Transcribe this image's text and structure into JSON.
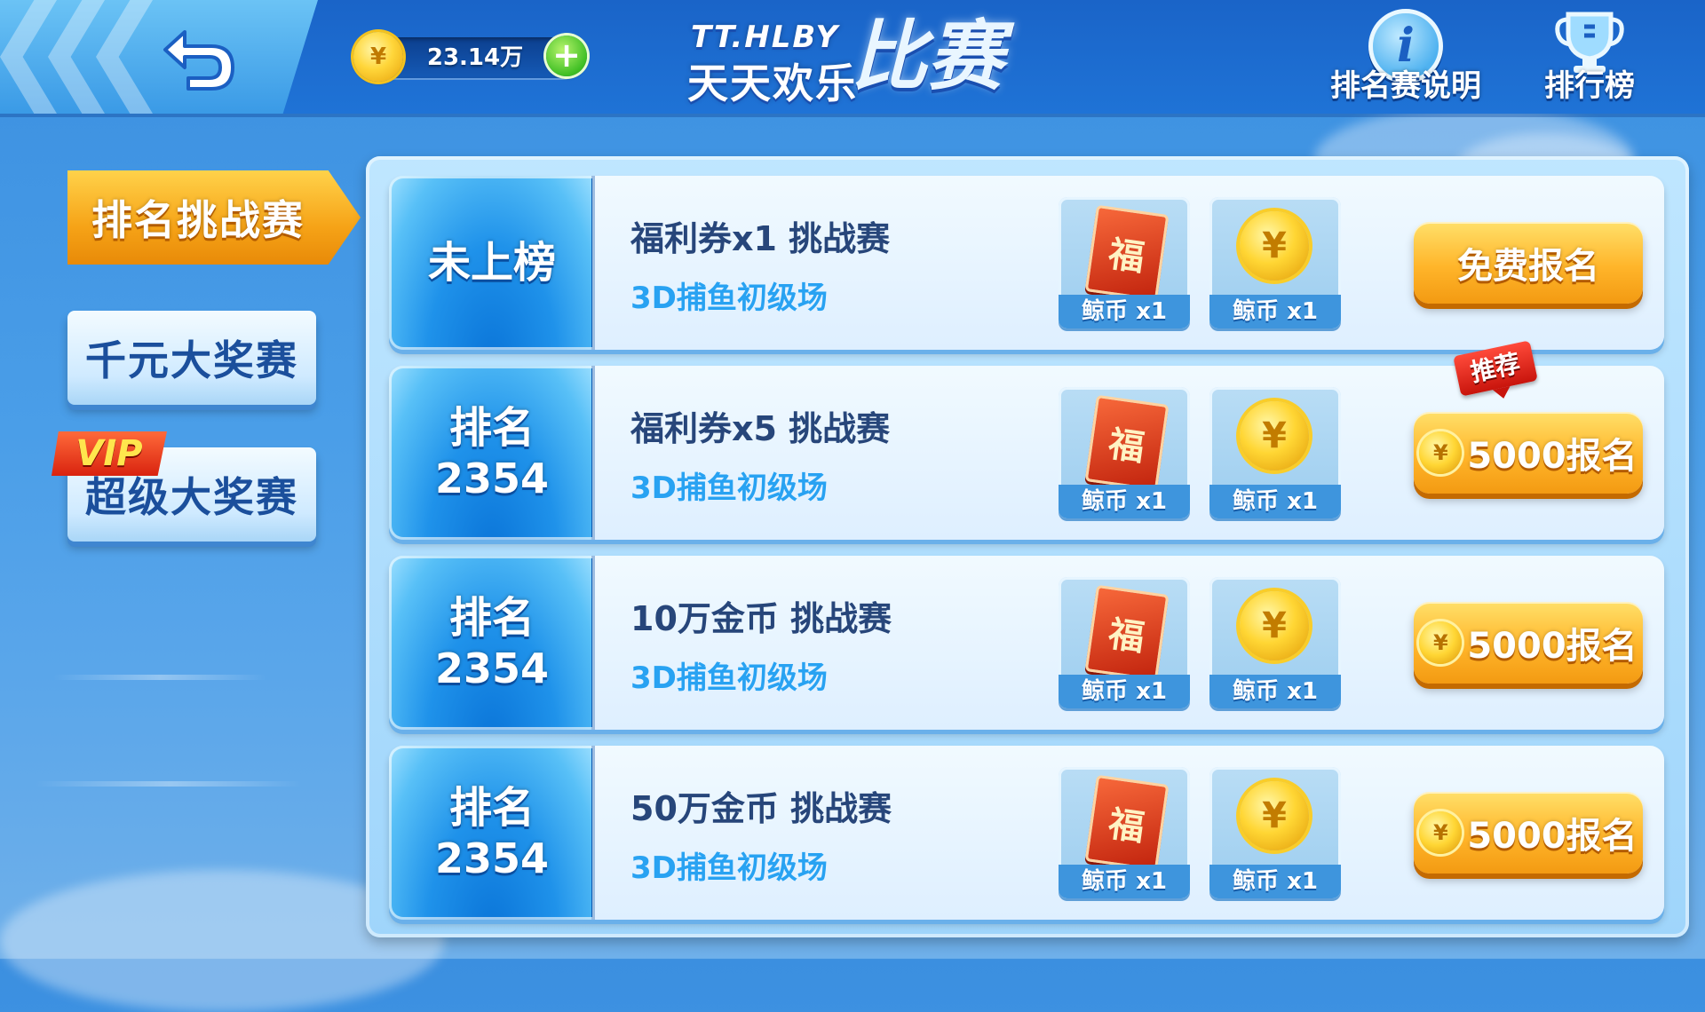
{
  "header": {
    "coin_balance": "23.14万",
    "logo_en": "TT.HLBY",
    "logo_cn": "天天欢乐",
    "logo_big": "比赛",
    "info_label": "排名赛说明",
    "leaderboard_label": "排行榜"
  },
  "nav": {
    "items": [
      {
        "label": "排名挑战赛",
        "active": true
      },
      {
        "label": "千元大奖赛",
        "active": false
      },
      {
        "label": "超级大奖赛",
        "active": false,
        "badge": "VIP"
      }
    ]
  },
  "rows": [
    {
      "rank_line1": "未上榜",
      "rank_line2": "",
      "title": "福利券x1 挑战赛",
      "subtitle": "3D捕鱼初级场",
      "reward1_caption": "鲸币 x1",
      "reward2_caption": "鲸币 x1",
      "button_label": "免费报名",
      "button_has_coin": false
    },
    {
      "rank_line1": "排名",
      "rank_line2": "2354",
      "title": "福利券x5 挑战赛",
      "subtitle": "3D捕鱼初级场",
      "reward1_caption": "鲸币 x1",
      "reward2_caption": "鲸币 x1",
      "button_label": "5000报名",
      "button_has_coin": true,
      "tag": "推荐"
    },
    {
      "rank_line1": "排名",
      "rank_line2": "2354",
      "title": "10万金币 挑战赛",
      "subtitle": "3D捕鱼初级场",
      "reward1_caption": "鲸币 x1",
      "reward2_caption": "鲸币 x1",
      "button_label": "5000报名",
      "button_has_coin": true
    },
    {
      "rank_line1": "排名",
      "rank_line2": "2354",
      "title": "50万金币 挑战赛",
      "subtitle": "3D捕鱼初级场",
      "reward1_caption": "鲸币 x1",
      "reward2_caption": "鲸币 x1",
      "button_label": "5000报名",
      "button_has_coin": true
    }
  ],
  "reward_card_glyph": "福",
  "colors": {
    "accent_orange": "#f6a317",
    "primary_blue": "#1f73d6",
    "title_text": "#27467a",
    "subtitle_text": "#28a2f2"
  }
}
